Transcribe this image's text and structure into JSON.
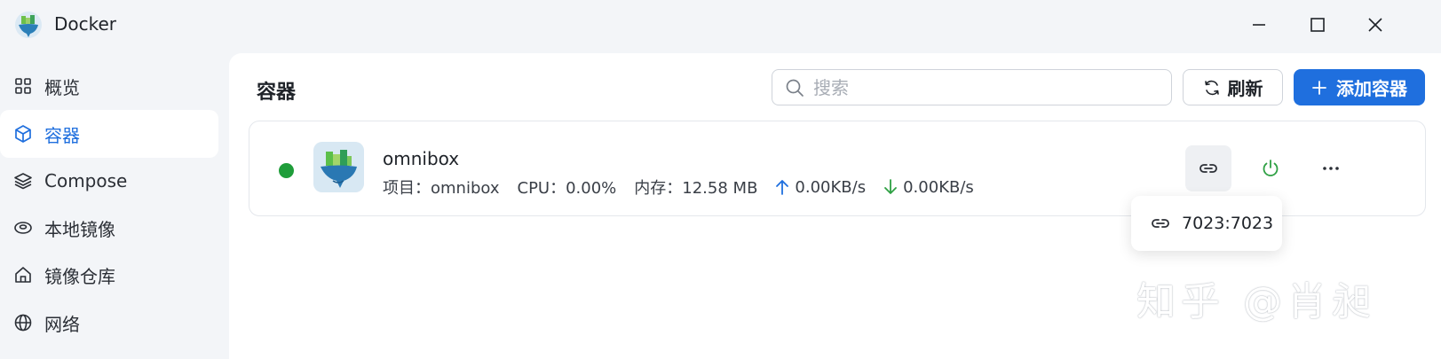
{
  "window": {
    "title": "Docker",
    "logo_icon": "docker-whale-logo"
  },
  "sidebar": {
    "items": [
      {
        "label": "概览",
        "icon": "grid-icon",
        "active": false
      },
      {
        "label": "容器",
        "icon": "cube-icon",
        "active": true
      },
      {
        "label": "Compose",
        "icon": "layers-icon",
        "active": false
      },
      {
        "label": "本地镜像",
        "icon": "disk-icon",
        "active": false
      },
      {
        "label": "镜像仓库",
        "icon": "home-icon",
        "active": false
      },
      {
        "label": "网络",
        "icon": "globe-icon",
        "active": false
      }
    ]
  },
  "main": {
    "title": "容器",
    "search": {
      "placeholder": "搜索",
      "value": ""
    },
    "refresh_label": "刷新",
    "add_label": "添加容器"
  },
  "container": {
    "name": "omnibox",
    "status": "running",
    "project": "项目：omnibox",
    "cpu": "CPU：0.00%",
    "memory": "内存：12.58 MB",
    "upload": "0.00KB/s",
    "download": "0.00KB/s"
  },
  "popover": {
    "port": "7023:7023"
  },
  "watermark": "知乎 @肖昶",
  "colors": {
    "accent": "#1f6fde",
    "status_running": "#1f9d3a",
    "power_icon": "#2ea043"
  }
}
